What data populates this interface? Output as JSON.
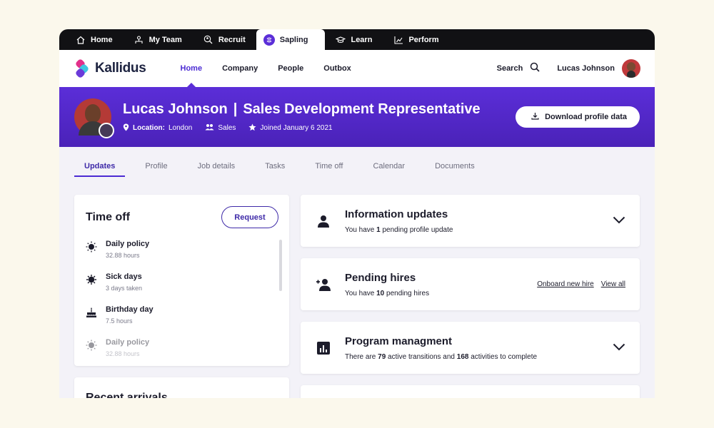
{
  "apptabs": [
    {
      "label": "Home",
      "icon": "home-icon"
    },
    {
      "label": "My Team",
      "icon": "team-icon"
    },
    {
      "label": "Recruit",
      "icon": "recruit-icon"
    },
    {
      "label": "Sapling",
      "icon": "sapling-icon",
      "active": true
    },
    {
      "label": "Learn",
      "icon": "graduation-cap-icon"
    },
    {
      "label": "Perform",
      "icon": "chart-icon"
    }
  ],
  "brand": {
    "name": "Kallidus",
    "accent": "#5b2ed8"
  },
  "nav": {
    "links": [
      "Home",
      "Company",
      "People",
      "Outbox"
    ],
    "active": "Home",
    "search_label": "Search",
    "user_name": "Lucas Johnson"
  },
  "profile": {
    "name": "Lucas Johnson",
    "separator": "|",
    "role": "Sales Development Representative",
    "location_label": "Location:",
    "location": "London",
    "department": "Sales",
    "joined": "Joined January 6 2021",
    "download_label": "Download profile data"
  },
  "subtabs": [
    "Updates",
    "Profile",
    "Job details",
    "Tasks",
    "Time off",
    "Calendar",
    "Documents"
  ],
  "timeoff": {
    "title": "Time off",
    "request_label": "Request",
    "policies": [
      {
        "name": "Daily policy",
        "detail": "32.88 hours",
        "icon": "sun-icon"
      },
      {
        "name": "Sick days",
        "detail": "3 days taken",
        "icon": "virus-icon"
      },
      {
        "name": "Birthday day",
        "detail": "7.5 hours",
        "icon": "cake-icon"
      },
      {
        "name": "Daily policy",
        "detail": "32.88 hours",
        "icon": "sun-icon"
      }
    ]
  },
  "recent": {
    "title": "Recent arrivals"
  },
  "updates": [
    {
      "title": "Information updates",
      "pre": "You have ",
      "count": "1",
      "post": " pending profile update",
      "icon": "person-icon"
    },
    {
      "title": "Pending hires",
      "pre": "You have ",
      "count": "10",
      "post": " pending hires",
      "icon": "person-add-icon",
      "link1": "Onboard new hire",
      "link2": "View all"
    },
    {
      "title": "Program managment",
      "pre": "There are ",
      "count": "79",
      "mid": " active transitions and ",
      "count2": "168",
      "post": " activities to complete",
      "icon": "bar-chart-icon"
    }
  ]
}
